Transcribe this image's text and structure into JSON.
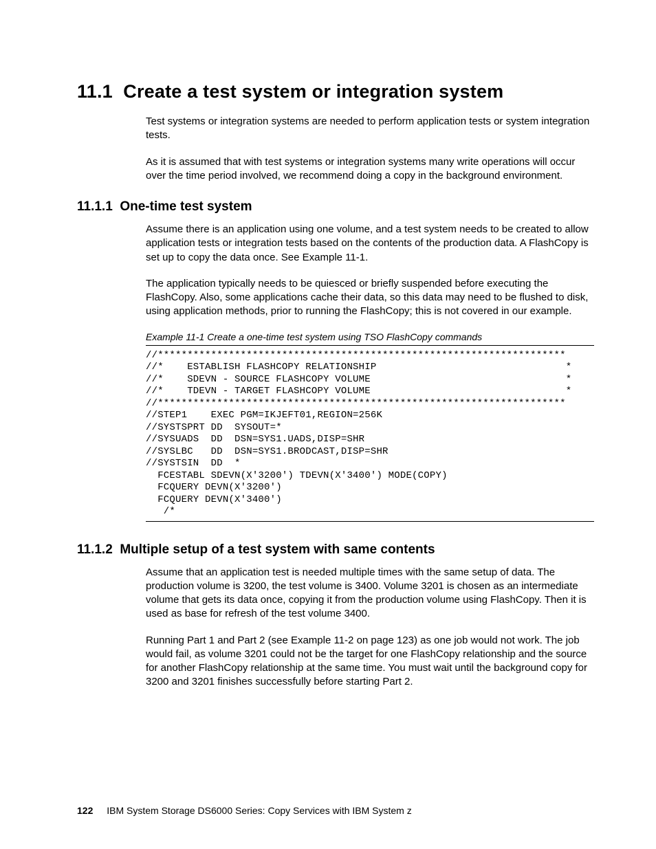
{
  "section": {
    "number": "11.1",
    "title": "Create a test system or integration system",
    "intro_p1": "Test systems or integration systems are needed to perform application tests or system integration tests.",
    "intro_p2": "As it is assumed that with test systems or integration systems many write operations will occur over the time period involved, we recommend doing a copy in the background environment."
  },
  "sub1": {
    "number": "11.1.1",
    "title": "One-time test system",
    "p1": "Assume there is an application using one volume, and a test system needs to be created to allow application tests or integration tests based on the contents of the production data. A FlashCopy is set up to copy the data once. See Example 11-1.",
    "p2": "The application typically needs to be quiesced or briefly suspended before executing the FlashCopy. Also, some applications cache their data, so this data may need to be flushed to disk, using application methods, prior to running the FlashCopy; this is not covered in our example.",
    "example_caption": "Example 11-1   Create a one-time test system using TSO FlashCopy commands",
    "code": "//*********************************************************************\n//*    ESTABLISH FLASHCOPY RELATIONSHIP                                *\n//*    SDEVN - SOURCE FLASHCOPY VOLUME                                 *\n//*    TDEVN - TARGET FLASHCOPY VOLUME                                 *\n//*********************************************************************\n//STEP1    EXEC PGM=IKJEFT01,REGION=256K\n//SYSTSPRT DD  SYSOUT=*\n//SYSUADS  DD  DSN=SYS1.UADS,DISP=SHR\n//SYSLBC   DD  DSN=SYS1.BRODCAST,DISP=SHR\n//SYSTSIN  DD  *\n  FCESTABL SDEVN(X'3200') TDEVN(X'3400') MODE(COPY)\n  FCQUERY DEVN(X'3200')\n  FCQUERY DEVN(X'3400')\n   /*"
  },
  "sub2": {
    "number": "11.1.2",
    "title": "Multiple setup of a test system with same contents",
    "p1": "Assume that an application test is needed multiple times with the same setup of data. The production volume is 3200, the test volume is 3400. Volume 3201 is chosen as an intermediate volume that gets its data once, copying it from the production volume using FlashCopy. Then it is used as base for refresh of the test volume 3400.",
    "p2": "Running Part 1 and Part 2 (see Example 11-2 on page 123) as one job would not work. The job would fail, as volume 3201 could not be the target for one FlashCopy relationship and the source for another FlashCopy relationship at the same time. You must wait until the background copy for 3200 and 3201 finishes successfully before starting Part 2."
  },
  "footer": {
    "page": "122",
    "doc_title": "IBM System Storage DS6000 Series: Copy Services with IBM System z"
  }
}
